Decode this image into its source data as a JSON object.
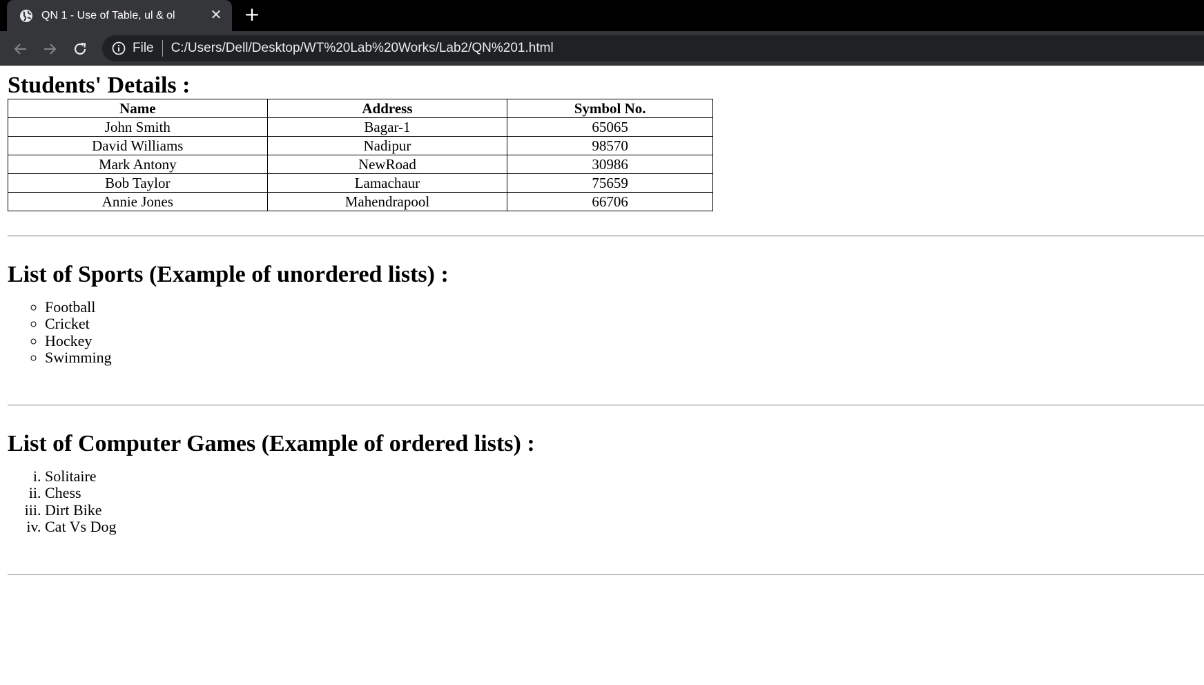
{
  "browser": {
    "tab_title": "QN 1 - Use of Table, ul & ol",
    "new_tab_symbol": "+",
    "close_symbol": "✕",
    "address_scheme": "File",
    "address_url": "C:/Users/Dell/Desktop/WT%20Lab%20Works/Lab2/QN%201.html"
  },
  "students": {
    "heading": "Students' Details :",
    "columns": [
      "Name",
      "Address",
      "Symbol No."
    ],
    "rows": [
      [
        "John Smith",
        "Bagar-1",
        "65065"
      ],
      [
        "David Williams",
        "Nadipur",
        "98570"
      ],
      [
        "Mark Antony",
        "NewRoad",
        "30986"
      ],
      [
        "Bob Taylor",
        "Lamachaur",
        "75659"
      ],
      [
        "Annie Jones",
        "Mahendrapool",
        "66706"
      ]
    ]
  },
  "sports": {
    "heading": "List of Sports (Example of unordered lists) :",
    "items": [
      "Football",
      "Cricket",
      "Hockey",
      "Swimming"
    ]
  },
  "games": {
    "heading": "List of Computer Games (Example of ordered lists) :",
    "items": [
      "Solitaire",
      "Chess",
      "Dirt Bike",
      "Cat Vs Dog"
    ]
  }
}
